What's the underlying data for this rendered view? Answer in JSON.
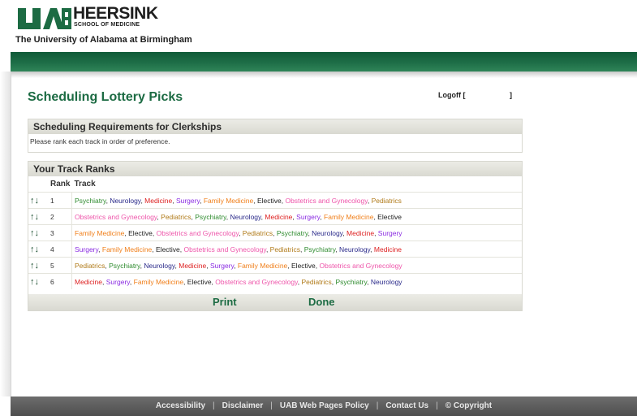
{
  "header": {
    "logo_text": "HEERSINK",
    "logo_subtext": "SCHOOL OF MEDICINE",
    "university": "The University of Alabama at Birmingham",
    "brand_color": "#1c6b43"
  },
  "page": {
    "title": "Scheduling Lottery Picks",
    "logoff_open": "Logoff [",
    "logoff_close": "]"
  },
  "requirements": {
    "heading": "Scheduling Requirements for Clerkships",
    "text": "Please rank each track in order of preference."
  },
  "ranks": {
    "heading": "Your Track Ranks",
    "col_rank": "Rank",
    "col_track": "Track",
    "arrow_up": "↑",
    "arrow_down": "↓",
    "rows": [
      {
        "rank": "1",
        "items": [
          "Psychiatry",
          "Neurology",
          "Medicine",
          "Surgery",
          "Family Medicine",
          "Elective",
          "Obstetrics and Gynecology",
          "Pediatrics"
        ]
      },
      {
        "rank": "2",
        "items": [
          "Obstetrics and Gynecology",
          "Pediatrics",
          "Psychiatry",
          "Neurology",
          "Medicine",
          "Surgery",
          "Family Medicine",
          "Elective"
        ]
      },
      {
        "rank": "3",
        "items": [
          "Family Medicine",
          "Elective",
          "Obstetrics and Gynecology",
          "Pediatrics",
          "Psychiatry",
          "Neurology",
          "Medicine",
          "Surgery"
        ]
      },
      {
        "rank": "4",
        "items": [
          "Surgery",
          "Family Medicine",
          "Elective",
          "Obstetrics and Gynecology",
          "Pediatrics",
          "Psychiatry",
          "Neurology",
          "Medicine"
        ]
      },
      {
        "rank": "5",
        "items": [
          "Pediatrics",
          "Psychiatry",
          "Neurology",
          "Medicine",
          "Surgery",
          "Family Medicine",
          "Elective",
          "Obstetrics and Gynecology"
        ]
      },
      {
        "rank": "6",
        "items": [
          "Medicine",
          "Surgery",
          "Family Medicine",
          "Elective",
          "Obstetrics and Gynecology",
          "Pediatrics",
          "Psychiatry",
          "Neurology"
        ]
      }
    ],
    "track_colors": {
      "Psychiatry": "#2e8b2e",
      "Neurology": "#2a2a8a",
      "Medicine": "#dd1f1f",
      "Surgery": "#8a2be2",
      "Family Medicine": "#f07f1a",
      "Elective": "#222222",
      "Obstetrics and Gynecology": "#ee55aa",
      "Pediatrics": "#b07a18"
    },
    "print_label": "Print",
    "done_label": "Done"
  },
  "footer": {
    "links": [
      "Accessibility",
      "Disclaimer",
      "UAB Web Pages Policy",
      "Contact Us",
      "© Copyright"
    ]
  }
}
